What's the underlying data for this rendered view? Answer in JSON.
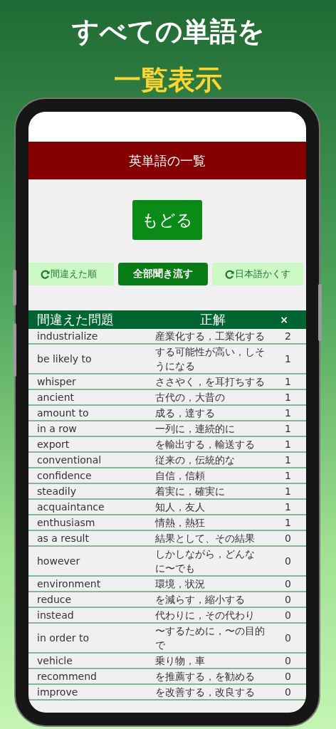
{
  "headline": {
    "line_1": "すべての単語を",
    "line_2": "一覧表示"
  },
  "app": {
    "title": "英単語の一覧",
    "back_button": "もどる",
    "buttons": [
      {
        "label": "間違えた順",
        "kind": "toggle"
      },
      {
        "label": "全部聞き流す",
        "kind": "primary"
      },
      {
        "label": "日本語かくす",
        "kind": "toggle"
      }
    ],
    "table": {
      "columns": [
        "間違えた問題",
        "正解",
        "×"
      ],
      "rows": [
        {
          "word": "industrialize",
          "meaning": "産業化する，工業化する",
          "count": "2"
        },
        {
          "word": "be likely to",
          "meaning": "する可能性が高い，しそうになる",
          "count": "1"
        },
        {
          "word": "whisper",
          "meaning": "ささやく，を耳打ちする",
          "count": "1"
        },
        {
          "word": "ancient",
          "meaning": "古代の，大昔の",
          "count": "1"
        },
        {
          "word": "amount to",
          "meaning": "成る，達する",
          "count": "1"
        },
        {
          "word": "in a row",
          "meaning": "一列に，連続的に",
          "count": "1"
        },
        {
          "word": "export",
          "meaning": "を輸出する，輸送する",
          "count": "1"
        },
        {
          "word": "conventional",
          "meaning": "従来の，伝統的な",
          "count": "1"
        },
        {
          "word": "confidence",
          "meaning": "自信，信頼",
          "count": "1"
        },
        {
          "word": "steadily",
          "meaning": "着実に，確実に",
          "count": "1"
        },
        {
          "word": "acquaintance",
          "meaning": "知人，友人",
          "count": "1"
        },
        {
          "word": "enthusiasm",
          "meaning": "情熱，熱狂",
          "count": "1"
        },
        {
          "word": "as a result",
          "meaning": "結果として、その結果",
          "count": "0"
        },
        {
          "word": "however",
          "meaning": "しかしながら，どんなに〜でも",
          "count": "0"
        },
        {
          "word": "environment",
          "meaning": "環境，状況",
          "count": "0"
        },
        {
          "word": "reduce",
          "meaning": "を減らす，縮小する",
          "count": "0"
        },
        {
          "word": "instead",
          "meaning": "代わりに，その代わり",
          "count": "0"
        },
        {
          "word": "in order to",
          "meaning": "〜するために，〜の目的で",
          "count": "0"
        },
        {
          "word": "vehicle",
          "meaning": "乗り物，車",
          "count": "0"
        },
        {
          "word": "recommend",
          "meaning": "を推薦する，を勧める",
          "count": "0"
        },
        {
          "word": "improve",
          "meaning": "を改善する，改良する",
          "count": "0"
        }
      ]
    }
  }
}
